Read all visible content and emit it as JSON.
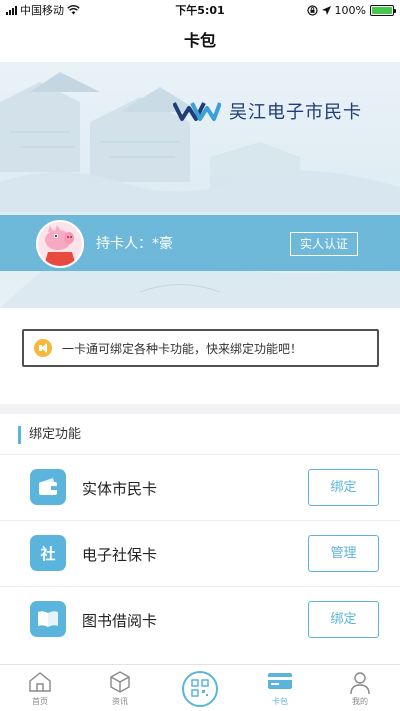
{
  "status_bar": {
    "carrier": "中国移动",
    "time": "下午5:01",
    "battery": "100%"
  },
  "nav": {
    "title": "卡包"
  },
  "card": {
    "brand_name": "吴江电子市民卡",
    "holder_label": "持卡人：",
    "holder_name": "*豪",
    "verify_button": "实人认证"
  },
  "notice": {
    "text": "一卡通可绑定各种卡功能，快来绑定功能吧！"
  },
  "bind_section": {
    "title": "绑定功能",
    "items": [
      {
        "label": "实体市民卡",
        "icon": "wallet-icon",
        "action": "绑定"
      },
      {
        "label": "电子社保卡",
        "icon": "social-security-icon",
        "icon_text": "社",
        "action": "管理"
      },
      {
        "label": "图书借阅卡",
        "icon": "book-icon",
        "action": "绑定"
      }
    ]
  },
  "tabbar": {
    "items": [
      {
        "label": "首页",
        "icon": "home-icon"
      },
      {
        "label": "资讯",
        "icon": "cube-icon"
      },
      {
        "label": "",
        "icon": "scan-qr-icon"
      },
      {
        "label": "卡包",
        "icon": "card-icon",
        "active": true
      },
      {
        "label": "我的",
        "icon": "person-icon"
      }
    ]
  },
  "colors": {
    "accent": "#5ab4dc",
    "brand": "#1f3e78",
    "battery": "#47c84a"
  }
}
